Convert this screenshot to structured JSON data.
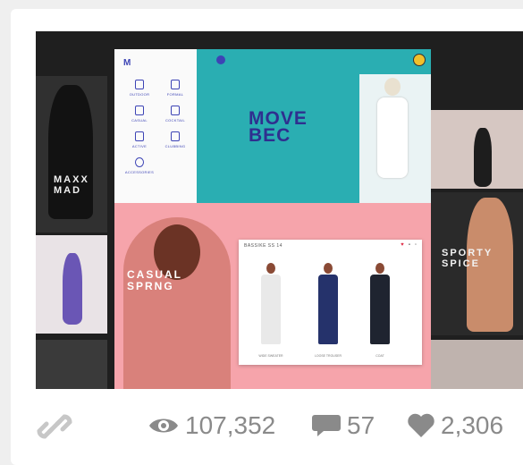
{
  "preview": {
    "tiles": {
      "left_top_label": "MAXX\nMAD",
      "right_mid_label": "SPORTY\nSPICE"
    },
    "panel": {
      "nav_items": [
        "OUTDOOR",
        "FORMAL",
        "CASUAL",
        "COCKTAIL",
        "ACTIVE",
        "CLUBBING",
        "ACCESSORIES"
      ],
      "hero_title": "MOVE\nBEC",
      "pink_label": "CASUAL\nSPRNG",
      "product_title": "BASSIKE SS 14",
      "product_labels": [
        "WIDE SWEATER",
        "LOOSE TROUSER",
        "COAT"
      ]
    }
  },
  "stats": {
    "views": "107,352",
    "comments": "57",
    "likes": "2,306"
  },
  "colors": {
    "teal": "#2aaeb2",
    "pink": "#f6a4ab",
    "indigo": "#3d44b5",
    "stat_gray": "#8a8a8a"
  },
  "icons": [
    "link-icon",
    "eye-icon",
    "comment-icon",
    "heart-icon"
  ]
}
